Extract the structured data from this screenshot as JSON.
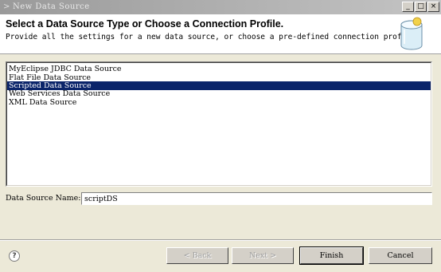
{
  "window": {
    "title": "New Data Source",
    "minimize": "_",
    "maximize": "□",
    "close": "×"
  },
  "header": {
    "title": "Select a Data Source Type or Choose a Connection Profile.",
    "description": "Provide all the settings for a new data source, or choose a pre-defined connection profile."
  },
  "list": {
    "items": [
      {
        "label": "MyEclipse JDBC Data Source",
        "selected": false
      },
      {
        "label": "Flat File Data Source",
        "selected": false
      },
      {
        "label": "Scripted Data Source",
        "selected": true
      },
      {
        "label": "Web Services Data Source",
        "selected": false
      },
      {
        "label": "XML Data Source",
        "selected": false
      }
    ]
  },
  "name_field": {
    "label": "Data Source Name:",
    "value": "scriptDS"
  },
  "buttons": {
    "help": "?",
    "back": "< Back",
    "next": "Next >",
    "finish": "Finish",
    "cancel": "Cancel"
  },
  "colors": {
    "selection": "#0a246a",
    "dialog_bg": "#ece9d8"
  }
}
